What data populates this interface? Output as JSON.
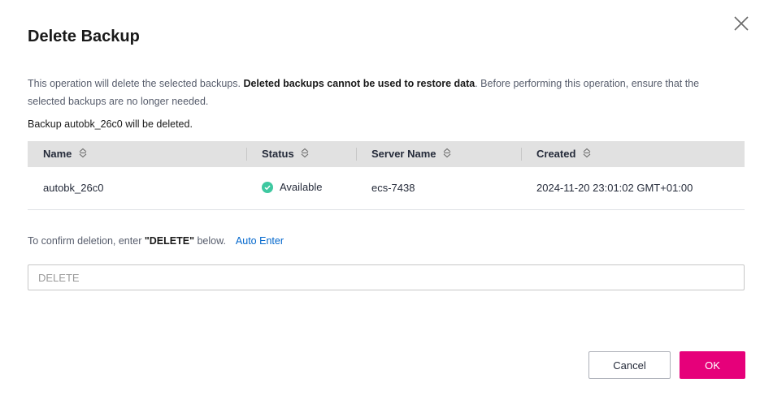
{
  "dialog": {
    "title": "Delete Backup",
    "close_icon": "close-icon",
    "description_part1": "This operation will delete the selected backups. ",
    "description_bold": "Deleted backups cannot be used to restore data",
    "description_part2": ". Before performing this operation, ensure that the selected backups are no longer needed.",
    "notice": "Backup autobk_26c0 will be deleted."
  },
  "table": {
    "columns": [
      "Name",
      "Status",
      "Server Name",
      "Created"
    ],
    "rows": [
      {
        "name": "autobk_26c0",
        "status": "Available",
        "server_name": "ecs-7438",
        "created": "2024-11-20 23:01:02 GMT+01:00"
      }
    ]
  },
  "confirm": {
    "prefix": "To confirm deletion, enter ",
    "keyword": "\"DELETE\"",
    "suffix": " below.",
    "auto_enter": "Auto Enter",
    "input_placeholder": "DELETE",
    "input_value": ""
  },
  "buttons": {
    "cancel": "Cancel",
    "ok": "OK"
  },
  "colors": {
    "primary": "#e6007a",
    "link": "#0066cc",
    "status_ok": "#3ec8a0",
    "header_bg": "#e1e1e1"
  }
}
